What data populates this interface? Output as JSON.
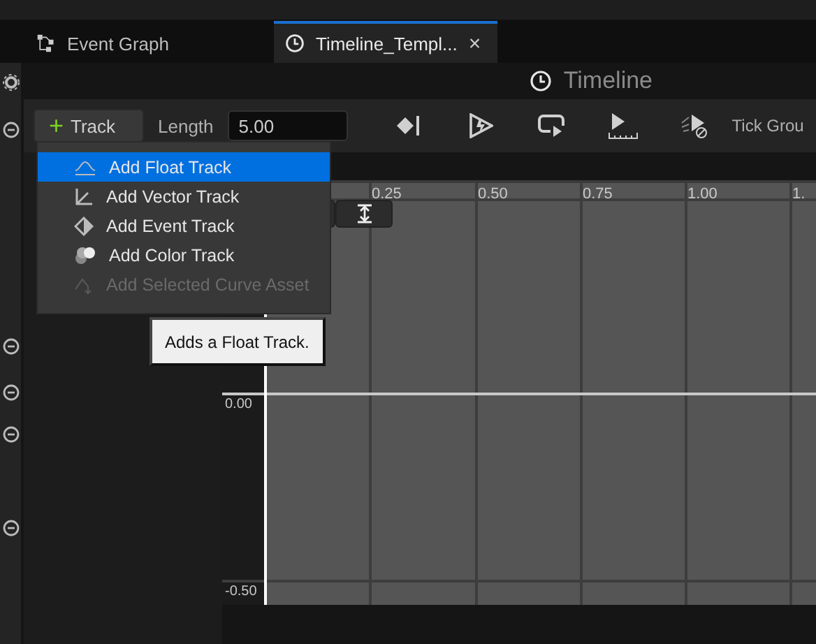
{
  "tabs": [
    {
      "label": "Event Graph",
      "selected": false,
      "closable": false
    },
    {
      "label": "Timeline_Templ...",
      "selected": true,
      "closable": true
    }
  ],
  "close_glyph": "×",
  "panel_title": "Timeline",
  "toolbar": {
    "track_button": {
      "icon": "+",
      "label": "Track"
    },
    "length_label": "Length",
    "length_value": "5.00",
    "tick_group": "Tick Grou"
  },
  "menu": [
    {
      "label": "Add Float Track",
      "selected": true,
      "disabled": false
    },
    {
      "label": "Add Vector Track",
      "selected": false,
      "disabled": false
    },
    {
      "label": "Add Event Track",
      "selected": false,
      "disabled": false
    },
    {
      "label": "Add Color Track",
      "selected": false,
      "disabled": false
    },
    {
      "label": "Add Selected Curve Asset",
      "selected": false,
      "disabled": true
    }
  ],
  "tooltip": "Adds a Float Track.",
  "graph": {
    "time_ticks": [
      "0.25",
      "0.50",
      "0.75",
      "1.00",
      "1."
    ],
    "value_labels": [
      "0.00",
      "-0.50"
    ]
  }
}
